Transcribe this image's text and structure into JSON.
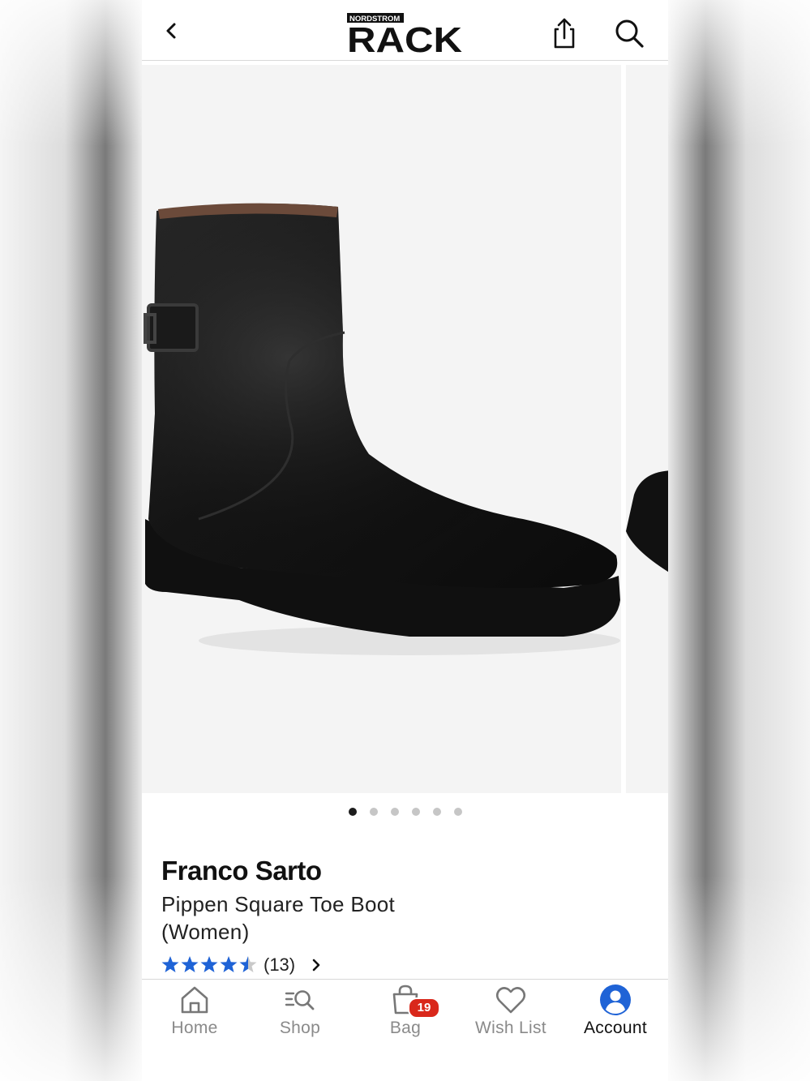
{
  "header": {
    "logo_top": "NORDSTROM",
    "logo_main": "RACK"
  },
  "gallery": {
    "image_count": 6,
    "active_index": 0
  },
  "product": {
    "brand": "Franco Sarto",
    "name": "Pippen Square Toe Boot (Women)",
    "rating": 4.5,
    "review_count": "(13)"
  },
  "tabbar": {
    "tabs": [
      {
        "label": "Home",
        "icon": "home-icon"
      },
      {
        "label": "Shop",
        "icon": "shop-search-icon"
      },
      {
        "label": "Bag",
        "icon": "bag-icon"
      },
      {
        "label": "Wish List",
        "icon": "heart-icon"
      },
      {
        "label": "Account",
        "icon": "account-icon"
      }
    ],
    "active": "Account",
    "bag_count": "19"
  },
  "colors": {
    "star": "#1f63d6",
    "badge": "#d9281b",
    "account_icon": "#1f63d6",
    "inactive_tab": "#8a8a8a"
  }
}
